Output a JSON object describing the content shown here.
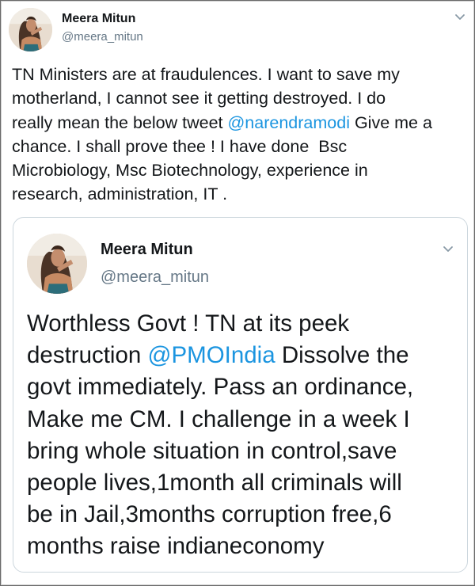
{
  "tweet": {
    "author": {
      "name": "Meera Mitun",
      "handle": "@meera_mitun"
    },
    "text_lines": [
      [
        "TN Ministers are at fraudulences. I want to save my"
      ],
      [
        "motherland, I cannot see it getting destroyed. I do"
      ],
      [
        "really mean the below tweet ",
        {
          "mention": "@narendramodi"
        },
        " Give me a"
      ],
      [
        "chance. I shall prove thee ! I have done  Bsc"
      ],
      [
        "Microbiology, Msc Biotechnology, experience in"
      ],
      [
        "research, administration, IT ."
      ]
    ]
  },
  "quoted_tweet": {
    "author": {
      "name": "Meera Mitun",
      "handle": "@meera_mitun"
    },
    "text_lines": [
      [
        "Worthless Govt ! TN at its peek"
      ],
      [
        "destruction ",
        {
          "mention": "@PMOIndia"
        },
        " Dissolve the"
      ],
      [
        "govt immediately. Pass an ordinance,"
      ],
      [
        "Make me CM. I challenge in a week I"
      ],
      [
        "bring whole situation in control,save"
      ],
      [
        "people lives,1month all criminals will"
      ],
      [
        "be in Jail,3months corruption free,6"
      ],
      [
        "months raise indianeconomy"
      ]
    ]
  },
  "colors": {
    "text": "#14171a",
    "secondary": "#657786",
    "link": "#1b95e0",
    "border": "#ccd6dd"
  },
  "icons": {
    "menu": "chevron-down-icon",
    "avatar": "profile-photo"
  }
}
